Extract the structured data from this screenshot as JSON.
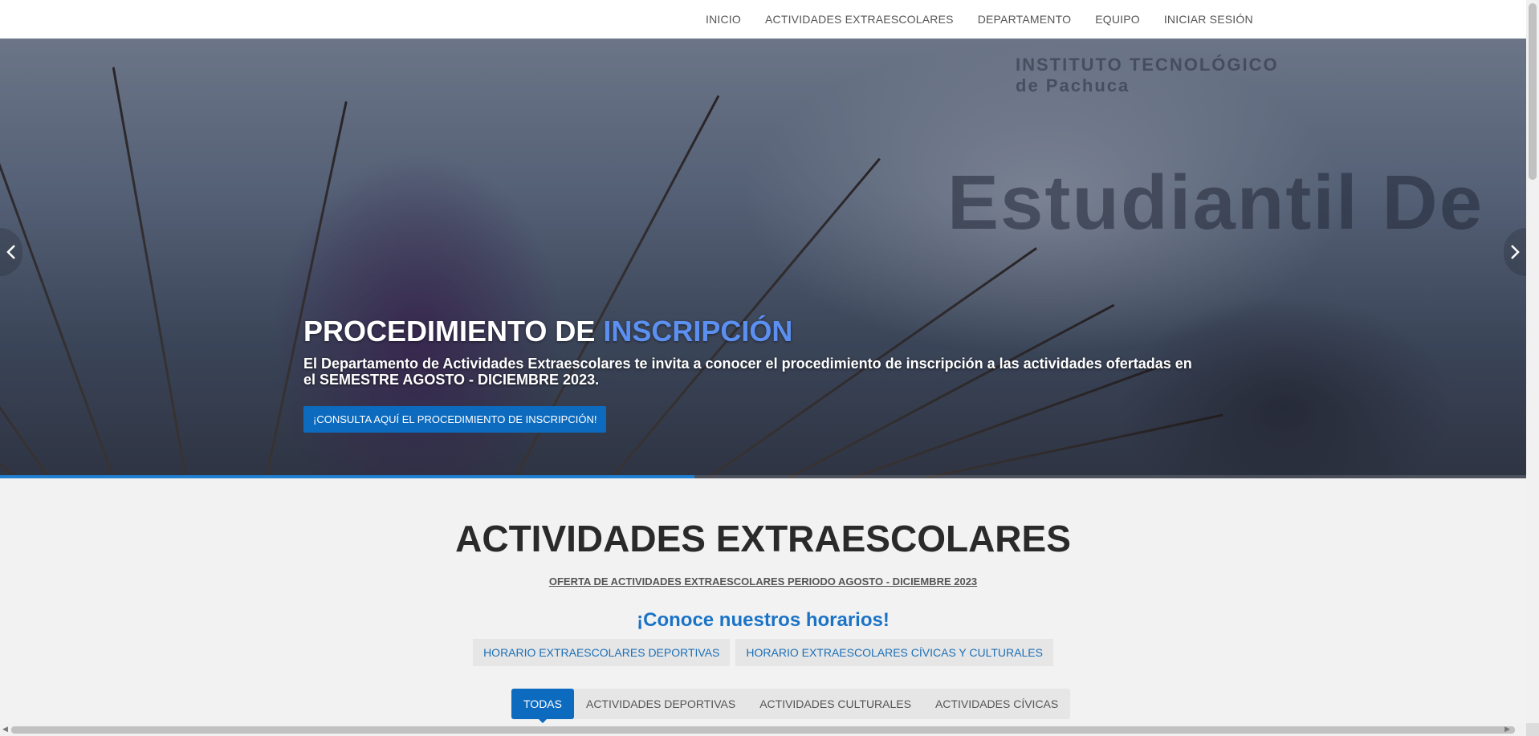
{
  "nav": {
    "items": [
      "INICIO",
      "ACTIVIDADES EXTRAESCOLARES",
      "DEPARTAMENTO",
      "EQUIPO",
      "INICIAR SESIÓN"
    ]
  },
  "hero": {
    "banner_text": "Estudiantil De",
    "banner_sub": "INSTITUTO TECNOLÓGICO de Pachuca",
    "title_main": "PROCEDIMIENTO DE ",
    "title_accent": "INSCRIPCIÓN",
    "description": "El Departamento de Actividades Extraescolares te invita a conocer el procedimiento de inscripción a las actividades ofertadas en el SEMESTRE AGOSTO - DICIEMBRE 2023.",
    "button_label": "¡CONSULTA AQUÍ EL PROCEDIMIENTO DE INSCRIPCIÓN!",
    "prev_icon": "‹",
    "next_icon": "›",
    "progress_fraction": 0.455,
    "accent_color": "#5b8ff0"
  },
  "section": {
    "title": "ACTIVIDADES EXTRAESCOLARES",
    "offer_link": "OFERTA DE ACTIVIDADES EXTRAESCOLARES PERIODO AGOSTO - DICIEMBRE 2023",
    "schedules_title": "¡Conoce nuestros horarios!",
    "schedule_buttons": [
      "HORARIO EXTRAESCOLARES DEPORTIVAS",
      "HORARIO EXTRAESCOLARES CÍVICAS Y CULTURALES"
    ],
    "tabs": [
      "TODAS",
      "ACTIVIDADES DEPORTIVAS",
      "ACTIVIDADES CULTURALES",
      "ACTIVIDADES CÍVICAS"
    ],
    "active_tab": 0
  },
  "colors": {
    "primary": "#0d6bbf",
    "link": "#1a6fb8",
    "heading": "#2a2a2a"
  }
}
